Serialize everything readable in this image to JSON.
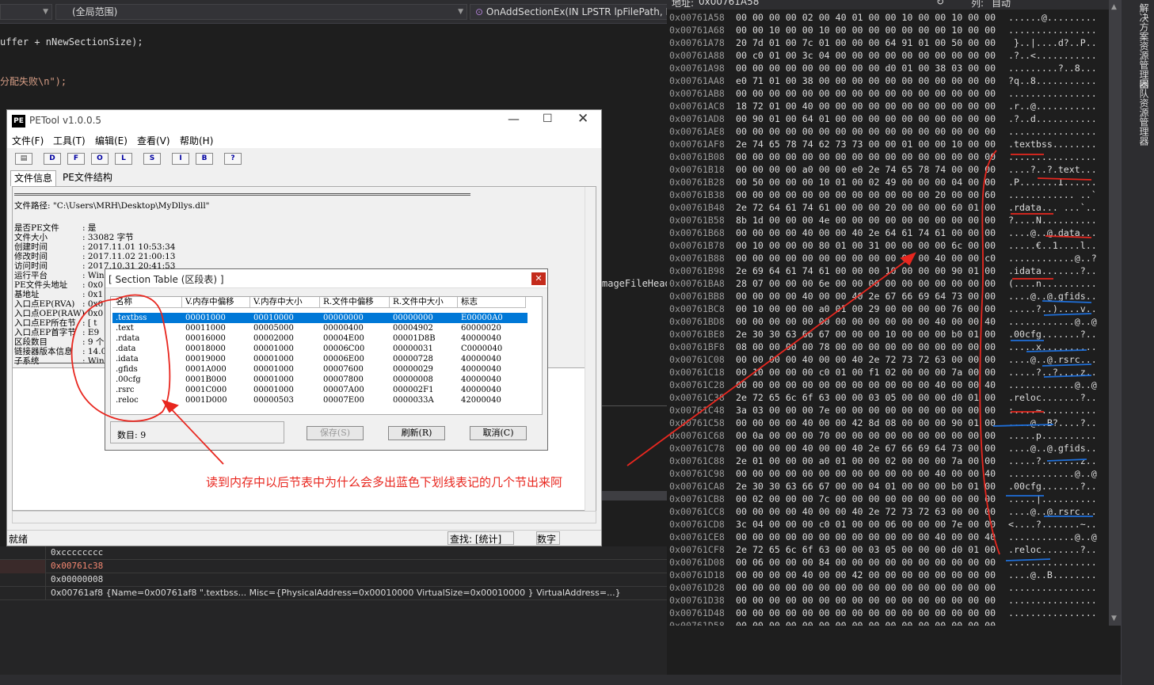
{
  "ide": {
    "scope_dropdown": "(全局范围)",
    "function_dropdown": "OnAddSectionEx(IN LPSTR lpFilePath, IN",
    "code_line1": "uffer + nNewSectionSize);",
    "code_line2": "分配失败\\n\");",
    "code_frag_right": "mageFileHead"
  },
  "watch": {
    "rows": [
      {
        "value": "0xcccccccc",
        "color": "#dcdcdc"
      },
      {
        "value": "0x00761c38",
        "color": "#f48771"
      },
      {
        "value": "0x00000008",
        "color": "#dcdcdc"
      },
      {
        "value": "0x00761af8 {Name=0x00761af8 \".textbss... Misc={PhysicalAddress=0x00010000 VirtualSize=0x00010000 } VirtualAddress=...}",
        "color": "#dcdcdc"
      }
    ]
  },
  "memory": {
    "address_label": "地址:",
    "address_value": "0x00761A58",
    "column_label": "列:",
    "column_value": "自动",
    "rows": [
      {
        "addr": "0x00761A58",
        "hex": "00 00 00 00 02 00 40 01 00 00 10 00 00 10 00 00",
        "ascii": "......@........."
      },
      {
        "addr": "0x00761A68",
        "hex": "00 00 10 00 00 10 00 00 00 00 00 00 00 10 00 00",
        "ascii": "................"
      },
      {
        "addr": "0x00761A78",
        "hex": "20 7d 01 00 7c 01 00 00 00 64 91 01 00 50 00 00",
        "ascii": " }..|....d?..P.."
      },
      {
        "addr": "0x00761A88",
        "hex": "00 c0 01 00 3c 04 00 00 00 00 00 00 00 00 00 00",
        "ascii": ".?..<..........."
      },
      {
        "addr": "0x00761A98",
        "hex": "00 00 00 00 00 00 00 00 00 d0 01 00 38 03 00 00",
        "ascii": ".........?..8..."
      },
      {
        "addr": "0x00761AA8",
        "hex": "e0 71 01 00 38 00 00 00 00 00 00 00 00 00 00 00",
        "ascii": "?q..8..........."
      },
      {
        "addr": "0x00761AB8",
        "hex": "00 00 00 00 00 00 00 00 00 00 00 00 00 00 00 00",
        "ascii": "................"
      },
      {
        "addr": "0x00761AC8",
        "hex": "18 72 01 00 40 00 00 00 00 00 00 00 00 00 00 00",
        "ascii": ".r..@..........."
      },
      {
        "addr": "0x00761AD8",
        "hex": "00 90 01 00 64 01 00 00 00 00 00 00 00 00 00 00",
        "ascii": ".?..d..........."
      },
      {
        "addr": "0x00761AE8",
        "hex": "00 00 00 00 00 00 00 00 00 00 00 00 00 00 00 00",
        "ascii": "................"
      },
      {
        "addr": "0x00761AF8",
        "hex": "2e 74 65 78 74 62 73 73 00 00 01 00 00 10 00 00",
        "ascii": ".textbss........"
      },
      {
        "addr": "0x00761B08",
        "hex": "00 00 00 00 00 00 00 00 00 00 00 00 00 00 00 00",
        "ascii": "................"
      },
      {
        "addr": "0x00761B18",
        "hex": "00 00 00 00 a0 00 00 e0 2e 74 65 78 74 00 00 00",
        "ascii": "....?..?.text..."
      },
      {
        "addr": "0x00761B28",
        "hex": "00 50 00 00 00 10 01 00 02 49 00 00 00 04 00 00",
        "ascii": ".P.......I......"
      },
      {
        "addr": "0x00761B38",
        "hex": "00 00 00 00 00 00 00 00 00 00 00 00 20 00 00 60",
        "ascii": "............ ..`"
      },
      {
        "addr": "0x00761B48",
        "hex": "2e 72 64 61 74 61 00 00 00 20 00 00 00 60 01 00",
        "ascii": ".rdata... ...`.."
      },
      {
        "addr": "0x00761B58",
        "hex": "8b 1d 00 00 00 4e 00 00 00 00 00 00 00 00 00 00",
        "ascii": "?....N.........."
      },
      {
        "addr": "0x00761B68",
        "hex": "00 00 00 00 40 00 00 40 2e 64 61 74 61 00 00 00",
        "ascii": "....@..@.data..."
      },
      {
        "addr": "0x00761B78",
        "hex": "00 10 00 00 00 80 01 00 31 00 00 00 00 6c 00 00",
        "ascii": ".....€..1....l.."
      },
      {
        "addr": "0x00761B88",
        "hex": "00 00 00 00 00 00 00 00 00 00 00 00 40 00 00 c0",
        "ascii": "............@..?"
      },
      {
        "addr": "0x00761B98",
        "hex": "2e 69 64 61 74 61 00 00 00 10 00 00 00 90 01 00",
        "ascii": ".idata.......?.."
      },
      {
        "addr": "0x00761BA8",
        "hex": "28 07 00 00 00 6e 00 00 00 00 00 00 00 00 00 00",
        "ascii": "(....n.........."
      },
      {
        "addr": "0x00761BB8",
        "hex": "00 00 00 00 40 00 00 40 2e 67 66 69 64 73 00 00",
        "ascii": "....@..@.gfids.."
      },
      {
        "addr": "0x00761BC8",
        "hex": "00 10 00 00 00 a0 01 00 29 00 00 00 00 76 00 00",
        "ascii": ".....?..)....v.."
      },
      {
        "addr": "0x00761BD8",
        "hex": "00 00 00 00 00 00 00 00 00 00 00 00 40 00 00 40",
        "ascii": "............@..@"
      },
      {
        "addr": "0x00761BE8",
        "hex": "2e 30 30 63 66 67 00 00 00 10 00 00 00 b0 01 00",
        "ascii": ".00cfg.......?.."
      },
      {
        "addr": "0x00761BF8",
        "hex": "08 00 00 00 00 78 00 00 00 00 00 00 00 00 00 00",
        "ascii": ".....x.........."
      },
      {
        "addr": "0x00761C08",
        "hex": "00 00 00 00 40 00 00 40 2e 72 73 72 63 00 00 00",
        "ascii": "....@..@.rsrc..."
      },
      {
        "addr": "0x00761C18",
        "hex": "00 10 00 00 00 c0 01 00 f1 02 00 00 00 7a 00 00",
        "ascii": ".....?..?....z.."
      },
      {
        "addr": "0x00761C28",
        "hex": "00 00 00 00 00 00 00 00 00 00 00 00 40 00 00 40",
        "ascii": "............@..@"
      },
      {
        "addr": "0x00761C38",
        "hex": "2e 72 65 6c 6f 63 00 00 03 05 00 00 00 d0 01 00",
        "ascii": ".reloc.......?.."
      },
      {
        "addr": "0x00761C48",
        "hex": "3a 03 00 00 00 7e 00 00 00 00 00 00 00 00 00 00",
        "ascii": ":....~.........."
      },
      {
        "addr": "0x00761C58",
        "hex": "00 00 00 00 40 00 00 42 8d 08 00 00 00 90 01 00",
        "ascii": "....@..B?....?.."
      },
      {
        "addr": "0x00761C68",
        "hex": "00 0a 00 00 00 70 00 00 00 00 00 00 00 00 00 00",
        "ascii": ".....p.........."
      },
      {
        "addr": "0x00761C78",
        "hex": "00 00 00 00 40 00 00 40 2e 67 66 69 64 73 00 00",
        "ascii": "....@..@.gfids.."
      },
      {
        "addr": "0x00761C88",
        "hex": "2e 01 00 00 00 a0 01 00 00 02 00 00 00 7a 00 00",
        "ascii": ".....?.......z.."
      },
      {
        "addr": "0x00761C98",
        "hex": "00 00 00 00 00 00 00 00 00 00 00 00 40 00 00 40",
        "ascii": "............@..@"
      },
      {
        "addr": "0x00761CA8",
        "hex": "2e 30 30 63 66 67 00 00 04 01 00 00 00 b0 01 00",
        "ascii": ".00cfg.......?.."
      },
      {
        "addr": "0x00761CB8",
        "hex": "00 02 00 00 00 7c 00 00 00 00 00 00 00 00 00 00",
        "ascii": ".....|.........."
      },
      {
        "addr": "0x00761CC8",
        "hex": "00 00 00 00 40 00 00 40 2e 72 73 72 63 00 00 00",
        "ascii": "....@..@.rsrc..."
      },
      {
        "addr": "0x00761CD8",
        "hex": "3c 04 00 00 00 c0 01 00 00 06 00 00 00 7e 00 00",
        "ascii": "<....?.......~.."
      },
      {
        "addr": "0x00761CE8",
        "hex": "00 00 00 00 00 00 00 00 00 00 00 00 40 00 00 40",
        "ascii": "............@..@"
      },
      {
        "addr": "0x00761CF8",
        "hex": "2e 72 65 6c 6f 63 00 00 03 05 00 00 00 d0 01 00",
        "ascii": ".reloc.......?.."
      },
      {
        "addr": "0x00761D08",
        "hex": "00 06 00 00 00 84 00 00 00 00 00 00 00 00 00 00",
        "ascii": "................"
      },
      {
        "addr": "0x00761D18",
        "hex": "00 00 00 00 40 00 00 42 00 00 00 00 00 00 00 00",
        "ascii": "....@..B........"
      },
      {
        "addr": "0x00761D28",
        "hex": "00 00 00 00 00 00 00 00 00 00 00 00 00 00 00 00",
        "ascii": "................"
      },
      {
        "addr": "0x00761D38",
        "hex": "00 00 00 00 00 00 00 00 00 00 00 00 00 00 00 00",
        "ascii": "................"
      },
      {
        "addr": "0x00761D48",
        "hex": "00 00 00 00 00 00 00 00 00 00 00 00 00 00 00 00",
        "ascii": "................"
      },
      {
        "addr": "0x00761D58",
        "hex": "00 00 00 00 00 00 00 00 00 00 00 00 00 00 00 00",
        "ascii": "................"
      }
    ]
  },
  "sidetabs": [
    "解决方案资源管理器",
    "团队资源管理器"
  ],
  "petool": {
    "title": "PETool v1.0.0.5",
    "icon_text": "PE",
    "menu": [
      "文件(F)",
      "工具(T)",
      "编辑(E)",
      "查看(V)",
      "帮助(H)"
    ],
    "toolbar": [
      "D",
      "F",
      "O",
      "L",
      "S",
      "I",
      "B",
      "?"
    ],
    "tabs": [
      "文件信息",
      "PE文件结构"
    ],
    "file_path_label": "文件路径:",
    "file_path": "\"C:\\Users\\MRH\\Desktop\\MyDllys.dll\"",
    "info": [
      {
        "k": "是否PE文件",
        "v": ": 是"
      },
      {
        "k": "文件大小",
        "v": ": 33082 字节"
      },
      {
        "k": "创建时间",
        "v": ": 2017.11.01 10:53:34"
      },
      {
        "k": "修改时间",
        "v": ": 2017.11.02 21:00:13"
      },
      {
        "k": "访问时间",
        "v": ": 2017.10.31 20:41:53"
      },
      {
        "k": "运行平台",
        "v": ": Win"
      },
      {
        "k": "PE文件头地址",
        "v": ": 0x0"
      },
      {
        "k": "基地址",
        "v": ": 0x1"
      },
      {
        "k": "入口点EP(RVA)",
        "v": ": 0x0"
      },
      {
        "k": "入口点OEP(RAW)",
        "v": ": 0x0"
      },
      {
        "k": "入口点EP所在节",
        "v": ": [ t"
      },
      {
        "k": "入口点EP首字节",
        "v": ": E9"
      },
      {
        "k": "区段数目",
        "v": ": 9 个"
      },
      {
        "k": "链接器版本信息",
        "v": ": 14.0"
      },
      {
        "k": "子系统",
        "v": ": Win"
      }
    ],
    "status_ready": "就绪",
    "status_find": "查找: [统计]",
    "status_num": "数字"
  },
  "dialog": {
    "title": "[ Section Table (区段表) ]",
    "headers": [
      "名称",
      "V.内存中偏移",
      "V.内存中大小",
      "R.文件中偏移",
      "R.文件中大小",
      "标志"
    ],
    "rows": [
      [
        ".textbss",
        "00001000",
        "00010000",
        "00000000",
        "00000000",
        "E00000A0"
      ],
      [
        ".text",
        "00011000",
        "00005000",
        "00000400",
        "00004902",
        "60000020"
      ],
      [
        ".rdata",
        "00016000",
        "00002000",
        "00004E00",
        "00001D8B",
        "40000040"
      ],
      [
        ".data",
        "00018000",
        "00001000",
        "00006C00",
        "00000031",
        "C0000040"
      ],
      [
        ".idata",
        "00019000",
        "00001000",
        "00006E00",
        "00000728",
        "40000040"
      ],
      [
        ".gfids",
        "0001A000",
        "00001000",
        "00007600",
        "00000029",
        "40000040"
      ],
      [
        ".00cfg",
        "0001B000",
        "00001000",
        "00007800",
        "00000008",
        "40000040"
      ],
      [
        ".rsrc",
        "0001C000",
        "00001000",
        "00007A00",
        "000002F1",
        "40000040"
      ],
      [
        ".reloc",
        "0001D000",
        "00000503",
        "00007E00",
        "0000033A",
        "42000040"
      ]
    ],
    "count_label": "数目: 9",
    "buttons": [
      "保存(S)",
      "刷新(R)",
      "取消(C)"
    ]
  },
  "annotation": "读到内存中以后节表中为什么会多出蓝色下划线表记的几个节出来阿",
  "colors": {
    "red_annotation": "#e8271f",
    "blue_underline": "#1e6fd9",
    "selection": "#0078d7"
  }
}
